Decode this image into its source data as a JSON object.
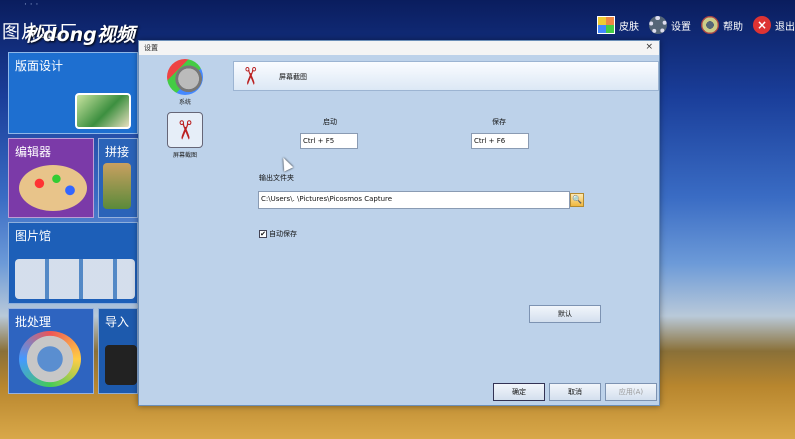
{
  "app": {
    "title": "图片工厂",
    "faint_title": "· · ·",
    "watermark": "秒dong视频"
  },
  "top_actions": [
    {
      "label": "皮肤",
      "icon": "skin-icon"
    },
    {
      "label": "设置",
      "icon": "gear-icon"
    },
    {
      "label": "帮助",
      "icon": "help-icon"
    },
    {
      "label": "退出",
      "icon": "exit-icon"
    }
  ],
  "tiles": {
    "layout": "版面设计",
    "editor": "编辑器",
    "stitch": "拼接",
    "gallery": "图片馆",
    "batch": "批处理",
    "import": "导入"
  },
  "dialog": {
    "title": "设置",
    "close": "×",
    "nav": {
      "system": "系统",
      "capture": "屏幕截图"
    },
    "section_title": "屏幕截图",
    "start_label": "启动",
    "save_label": "保存",
    "start_hotkey": "Ctrl + F5",
    "save_hotkey": "Ctrl + F6",
    "output_folder_label": "输出文件夹",
    "output_folder_value": "C:\\Users\\.  \\Pictures\\Picosmos Capture",
    "autosave_label": "自动保存",
    "autosave_checked": "✔",
    "default_button": "默认",
    "ok_button": "确定",
    "cancel_button": "取消",
    "apply_button": "应用(A)"
  },
  "colors": {
    "dialog_bg": "#bdd2ea",
    "accent_red": "#b22222"
  }
}
